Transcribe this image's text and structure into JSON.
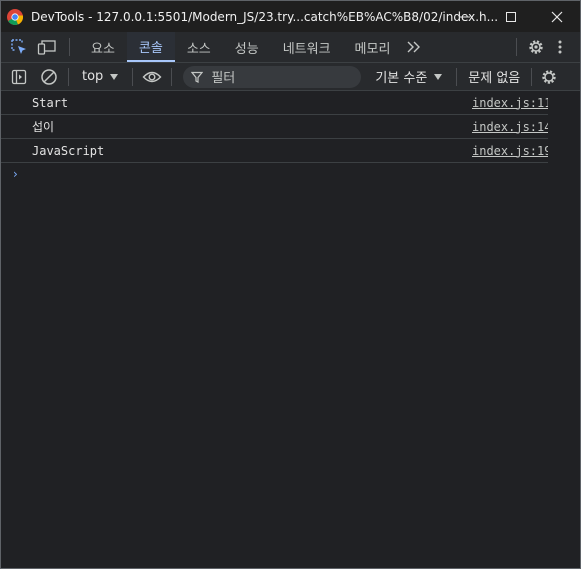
{
  "window": {
    "title": "DevTools - 127.0.0.1:5501/Modern_JS/23.try...catch%EB%AC%B8/02/index.h...",
    "minimize": "—",
    "maximize": "☐",
    "close": "✕"
  },
  "tabs": [
    {
      "label": "요소",
      "active": false
    },
    {
      "label": "콘솔",
      "active": true
    },
    {
      "label": "소스",
      "active": false
    },
    {
      "label": "성능",
      "active": false
    },
    {
      "label": "네트워크",
      "active": false
    },
    {
      "label": "메모리",
      "active": false
    }
  ],
  "tabs_more": "»",
  "toolbar": {
    "context": "top",
    "filter_placeholder": "필터",
    "levels": "기본 수준",
    "issues": "문제 없음"
  },
  "messages": [
    {
      "text": "Start",
      "source": "index.js:11"
    },
    {
      "text": "섭이",
      "source": "index.js:14"
    },
    {
      "text": "JavaScript",
      "source": "index.js:19"
    }
  ],
  "prompt": "›",
  "colors": {
    "accent": "#a8c7fa",
    "background": "#202124",
    "toolbar": "#282a2d"
  }
}
